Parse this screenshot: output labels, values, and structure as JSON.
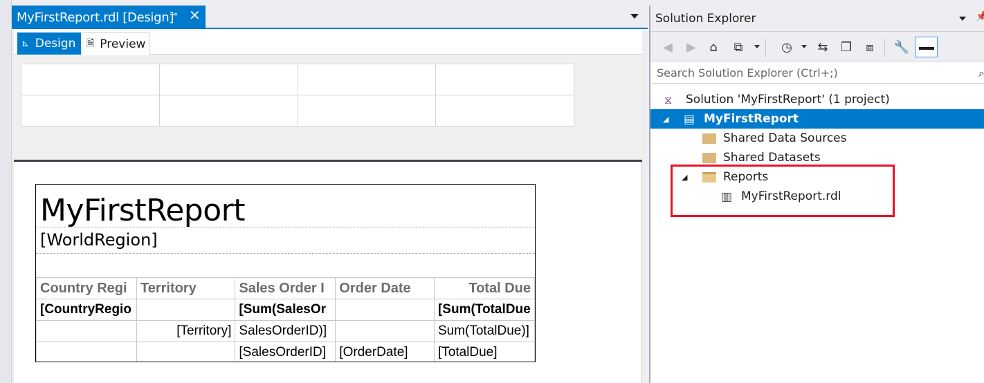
{
  "document": {
    "tab_title": "MyFirstReport.rdl [Design]",
    "pin_glyph": "⊸",
    "close_glyph": "✕"
  },
  "view_tabs": [
    {
      "label": "Design",
      "active": true
    },
    {
      "label": "Preview",
      "active": false
    }
  ],
  "report": {
    "title": "MyFirstReport",
    "region_field": "[WorldRegion]",
    "columns": [
      "Country Regi",
      "Territory",
      "Sales Order I",
      "Order Date",
      "Total Due"
    ],
    "group_row": [
      "[CountryRegio",
      "",
      "[Sum(SalesOr",
      "",
      "[Sum(TotalDue"
    ],
    "subgroup_row": [
      "",
      "[Territory]",
      "SalesOrderID)]",
      "",
      "Sum(TotalDue)]"
    ],
    "detail_row": [
      "",
      "",
      "[SalesOrderID]",
      "[OrderDate]",
      "[TotalDue]"
    ]
  },
  "solution_explorer": {
    "title": "Solution Explorer",
    "search_placeholder": "Search Solution Explorer (Ctrl+;)",
    "tree": {
      "solution": "Solution 'MyFirstReport' (1 project)",
      "project": "MyFirstReport",
      "shared_data_sources": "Shared Data Sources",
      "shared_datasets": "Shared Datasets",
      "reports_folder": "Reports",
      "report_file": "MyFirstReport.rdl"
    }
  },
  "colors": {
    "accent": "#007acc",
    "highlight_box": "#e81123",
    "folder": "#dcb67a"
  }
}
